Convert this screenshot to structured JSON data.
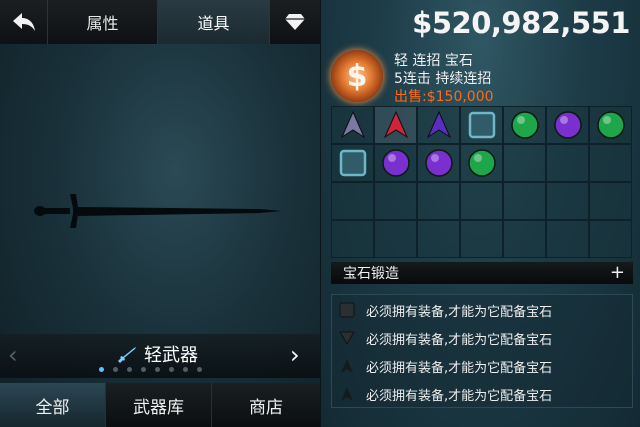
{
  "tabs": {
    "back_icon": "back-arrow-icon",
    "attributes": "属性",
    "items": "道具",
    "gem_icon": "diamond-icon"
  },
  "category": {
    "label": "轻武器",
    "icon": "sword-icon",
    "page_count": 8,
    "current_page": 1
  },
  "bottom_tabs": {
    "all": "全部",
    "armory": "武器库",
    "shop": "商店"
  },
  "currency": "$520,982,551",
  "gem_info": {
    "icon_symbol": "$",
    "line1": "轻 连招 宝石",
    "line2": "5连击 持续连招",
    "sell": "出售:$150,000"
  },
  "gem_grid": {
    "rows": 4,
    "cols": 7,
    "items": [
      {
        "type": "shard",
        "color": "#7a7aa0"
      },
      {
        "type": "shard",
        "color": "#d0243a"
      },
      {
        "type": "shard",
        "color": "#5a2ec0"
      },
      {
        "type": "square",
        "color": "#6fb7c8"
      },
      {
        "type": "round",
        "color": "#1fa64a"
      },
      {
        "type": "round",
        "color": "#7a2fcf"
      },
      {
        "type": "round",
        "color": "#1fa64a"
      },
      {
        "type": "square",
        "color": "#6fb7c8"
      },
      {
        "type": "round",
        "color": "#7a2fcf"
      },
      {
        "type": "round",
        "color": "#7a2fcf"
      },
      {
        "type": "round",
        "color": "#1fa64a"
      }
    ],
    "selected_index": 1
  },
  "forge": {
    "label": "宝石锻造",
    "plus": "+"
  },
  "requirements": [
    {
      "icon": "square-slot-icon",
      "text": "必须拥有装备,才能为它配备宝石"
    },
    {
      "icon": "triangle-slot-icon",
      "text": "必须拥有装备,才能为它配备宝石"
    },
    {
      "icon": "shard-slot-icon",
      "text": "必须拥有装备,才能为它配备宝石"
    },
    {
      "icon": "shard-slot-icon",
      "text": "必须拥有装备,才能为它配备宝石"
    }
  ]
}
